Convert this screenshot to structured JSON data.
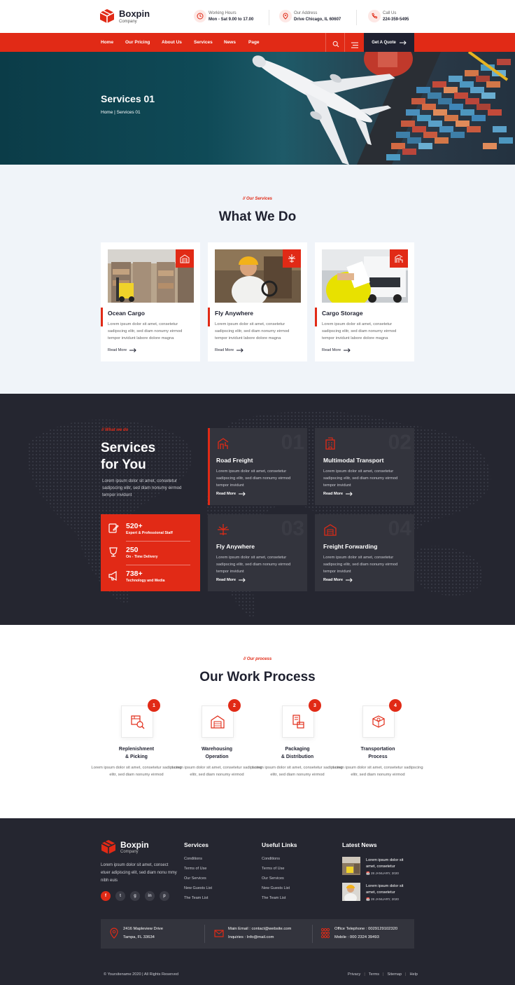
{
  "brand": {
    "name": "Boxpin",
    "tagline": "Company",
    "accent": "#e12a16",
    "dark": "#252630"
  },
  "header": {
    "working_hours": {
      "label": "Working Hours",
      "value": "Mon - Sat 9.00 to 17.00",
      "icon": "clock-icon"
    },
    "address": {
      "label": "Our Address",
      "value": "Drive Chicago, IL 60607",
      "icon": "map-pin-icon"
    },
    "call": {
      "label": "Call Us",
      "value": "224-359-5495",
      "icon": "phone-icon"
    }
  },
  "nav": {
    "items": [
      "Home",
      "Our Pricing",
      "About Us",
      "Services",
      "News",
      "Page"
    ],
    "cta": "Get A Quote"
  },
  "hero": {
    "title": "Services 01",
    "breadcrumb": "Home | Services 01"
  },
  "what_we_do": {
    "kicker": "// Our Services",
    "title": "What We Do",
    "cards": [
      {
        "title": "Ocean Cargo",
        "desc": "Lorem ipsum dolor sit amet, consetetur sadipscing elitr, sed diam nonumy eirmod tempor invidunt labore dolore magna",
        "link": "Read More",
        "icon": "warehouse-icon"
      },
      {
        "title": "Fly Anywhere",
        "desc": "Lorem ipsum dolor sit amet, consetetur sadipscing elitr, sed diam nonumy eirmod tempor invidunt labore dolore magna",
        "link": "Read More",
        "icon": "airplane-icon"
      },
      {
        "title": "Cargo Storage",
        "desc": "Lorem ipsum dolor sit amet, consetetur sadipscing elitr, sed diam nonumy eirmod tempor invidunt labore dolore magna",
        "link": "Read More",
        "icon": "crane-icon"
      }
    ]
  },
  "services": {
    "kicker": "// What we do",
    "title_line1": "Services",
    "title_line2": "for You",
    "desc": "Lorem ipsum dolor sit amet, consetetur sadipscing elitr, sed diam nonumy eirmod tempor invidunt",
    "stats": [
      {
        "number": "520+",
        "label": "Expert & Professional Staff",
        "icon": "edit-document-icon"
      },
      {
        "number": "250",
        "label": "On - Time Delivery",
        "icon": "trophy-icon"
      },
      {
        "number": "738+",
        "label": "Technology and Media",
        "icon": "megaphone-icon"
      }
    ],
    "boxes": [
      {
        "num": "01",
        "title": "Road Freight",
        "desc": "Lorem ipsum dolor sit amet, consetetur sadipscing elitr, sed diam nonumy eirmod tempor invidunt",
        "link": "Read More",
        "icon": "crane-icon"
      },
      {
        "num": "02",
        "title": "Multimodal Transport",
        "desc": "Lorem ipsum dolor sit amet, consetetur sadipscing elitr, sed diam nonumy eirmod tempor invidunt",
        "link": "Read More",
        "icon": "building-icon"
      },
      {
        "num": "03",
        "title": "Fly Anywhere",
        "desc": "Lorem ipsum dolor sit amet, consetetur sadipscing elitr, sed diam nonumy eirmod tempor invidunt",
        "link": "Read More",
        "icon": "airplane-icon"
      },
      {
        "num": "04",
        "title": "Freight Forwarding",
        "desc": "Lorem ipsum dolor sit amet, consetetur sadipscing elitr, sed diam nonumy eirmod tempor invidunt",
        "link": "Read More",
        "icon": "warehouse-icon"
      }
    ]
  },
  "process": {
    "kicker": "// Our process",
    "title": "Our Work Process",
    "steps": [
      {
        "n": "1",
        "title1": "Replenishment",
        "title2": "& Picking",
        "desc": "Lorem ipsum dolor sit amet, consetetur sadipscing elitr, sed diam nonumy eirmod",
        "icon": "box-search-icon"
      },
      {
        "n": "2",
        "title1": "Warehousing",
        "title2": "Operation",
        "desc": "Lorem ipsum dolor sit amet, consetetur sadipscing elitr, sed diam nonumy eirmod",
        "icon": "warehouse-icon"
      },
      {
        "n": "3",
        "title1": "Packaging",
        "title2": "& Distribution",
        "desc": "Lorem ipsum dolor sit amet, consetetur sadipscing elitr, sed diam nonumy eirmod",
        "icon": "package-icon"
      },
      {
        "n": "4",
        "title1": "Transportation",
        "title2": "Process",
        "desc": "Lorem ipsum dolor sit amet, consetetur sadipscing elitr, sed diam nonumy eirmod",
        "icon": "shipping-box-icon"
      }
    ]
  },
  "footer": {
    "about": "Lorem ipsum dolor sit amet, consect etuer adipiscing elit, sed diam nonu mmy nibh euis",
    "socials": [
      "facebook-icon",
      "twitter-icon",
      "google-icon",
      "linkedin-icon",
      "pinterest-icon"
    ],
    "services_title": "Services",
    "services_links": [
      "Conditions",
      "Terms of Use",
      "Our Services",
      "New Guests List",
      "The Team List"
    ],
    "useful_title": "Useful Links",
    "useful_links": [
      "Conditions",
      "Terms of Use",
      "Our Services",
      "New Guests List",
      "The Team List"
    ],
    "news_title": "Latest News",
    "news": [
      {
        "title": "Lorem ipsum dolor sit amet, consetetur",
        "date": "28 JANUARY, 2020"
      },
      {
        "title": "Lorem ipsum dolor sit amet, consetetur",
        "date": "28 JANUARY, 2020"
      }
    ],
    "contact": {
      "address1": "2416 Mapleview Drive",
      "address2": "Tampa, FL 33634",
      "email1": "Main Email : contact@website.com",
      "email2": "Inquiries : Info@mail.com",
      "phone1": "Office Telephone : 0029129102320",
      "phone2": "Mobile : 000 2324 39493"
    },
    "copyright": "© Yoursitename 2020 | All Rights Reserved",
    "legal": [
      "Privacy",
      "Terms",
      "Sitemap",
      "Help"
    ]
  }
}
